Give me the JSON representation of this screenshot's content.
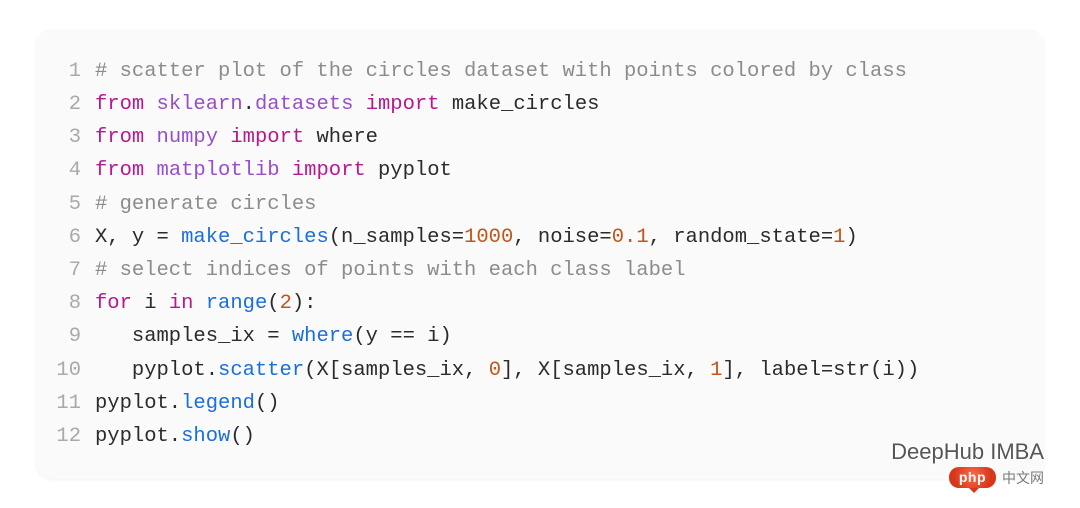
{
  "watermark": {
    "top": "DeepHub IMBA",
    "badge": "php",
    "suffix": "中文网"
  },
  "colors": {
    "keyword": "#b91790",
    "module": "#984eca",
    "function": "#1a6fdb",
    "number": "#c2561a",
    "comment": "#8c8c8c",
    "lineno": "#a9a9a9",
    "text": "#2b2b2b",
    "card_bg": "#fafafa"
  },
  "lines": [
    {
      "n": "1",
      "tokens": [
        {
          "cls": "c",
          "t": "# scatter plot of the circles dataset with points colored by class"
        }
      ]
    },
    {
      "n": "2",
      "tokens": [
        {
          "cls": "kw",
          "t": "from"
        },
        {
          "cls": "code",
          "t": " "
        },
        {
          "cls": "mod",
          "t": "sklearn"
        },
        {
          "cls": "code",
          "t": "."
        },
        {
          "cls": "mod",
          "t": "datasets"
        },
        {
          "cls": "code",
          "t": " "
        },
        {
          "cls": "kw",
          "t": "import"
        },
        {
          "cls": "code",
          "t": " make_circles"
        }
      ]
    },
    {
      "n": "3",
      "tokens": [
        {
          "cls": "kw",
          "t": "from"
        },
        {
          "cls": "code",
          "t": " "
        },
        {
          "cls": "mod",
          "t": "numpy"
        },
        {
          "cls": "code",
          "t": " "
        },
        {
          "cls": "kw",
          "t": "import"
        },
        {
          "cls": "code",
          "t": " where"
        }
      ]
    },
    {
      "n": "4",
      "tokens": [
        {
          "cls": "kw",
          "t": "from"
        },
        {
          "cls": "code",
          "t": " "
        },
        {
          "cls": "mod",
          "t": "matplotlib"
        },
        {
          "cls": "code",
          "t": " "
        },
        {
          "cls": "kw",
          "t": "import"
        },
        {
          "cls": "code",
          "t": " pyplot"
        }
      ]
    },
    {
      "n": "5",
      "tokens": [
        {
          "cls": "c",
          "t": "# generate circles"
        }
      ]
    },
    {
      "n": "6",
      "tokens": [
        {
          "cls": "code",
          "t": "X, y = "
        },
        {
          "cls": "fn",
          "t": "make_circles"
        },
        {
          "cls": "code",
          "t": "(n_samples="
        },
        {
          "cls": "num",
          "t": "1000"
        },
        {
          "cls": "code",
          "t": ", noise="
        },
        {
          "cls": "num",
          "t": "0.1"
        },
        {
          "cls": "code",
          "t": ", random_state="
        },
        {
          "cls": "num",
          "t": "1"
        },
        {
          "cls": "code",
          "t": ")"
        }
      ]
    },
    {
      "n": "7",
      "tokens": [
        {
          "cls": "c",
          "t": "# select indices of points with each class label"
        }
      ]
    },
    {
      "n": "8",
      "tokens": [
        {
          "cls": "kw",
          "t": "for"
        },
        {
          "cls": "code",
          "t": " i "
        },
        {
          "cls": "kw",
          "t": "in"
        },
        {
          "cls": "code",
          "t": " "
        },
        {
          "cls": "fn",
          "t": "range"
        },
        {
          "cls": "code",
          "t": "("
        },
        {
          "cls": "num",
          "t": "2"
        },
        {
          "cls": "code",
          "t": "):"
        }
      ]
    },
    {
      "n": "9",
      "tokens": [
        {
          "cls": "code",
          "t": "   samples_ix = "
        },
        {
          "cls": "fn",
          "t": "where"
        },
        {
          "cls": "code",
          "t": "(y == i)"
        }
      ]
    },
    {
      "n": "10",
      "tokens": [
        {
          "cls": "code",
          "t": "   pyplot."
        },
        {
          "cls": "fn",
          "t": "scatter"
        },
        {
          "cls": "code",
          "t": "(X[samples_ix, "
        },
        {
          "cls": "num",
          "t": "0"
        },
        {
          "cls": "code",
          "t": "], X[samples_ix, "
        },
        {
          "cls": "num",
          "t": "1"
        },
        {
          "cls": "code",
          "t": "], label=str(i))"
        }
      ]
    },
    {
      "n": "11",
      "tokens": [
        {
          "cls": "code",
          "t": "pyplot."
        },
        {
          "cls": "fn",
          "t": "legend"
        },
        {
          "cls": "code",
          "t": "()"
        }
      ]
    },
    {
      "n": "12",
      "tokens": [
        {
          "cls": "code",
          "t": "pyplot."
        },
        {
          "cls": "fn",
          "t": "show"
        },
        {
          "cls": "code",
          "t": "()"
        }
      ]
    }
  ]
}
